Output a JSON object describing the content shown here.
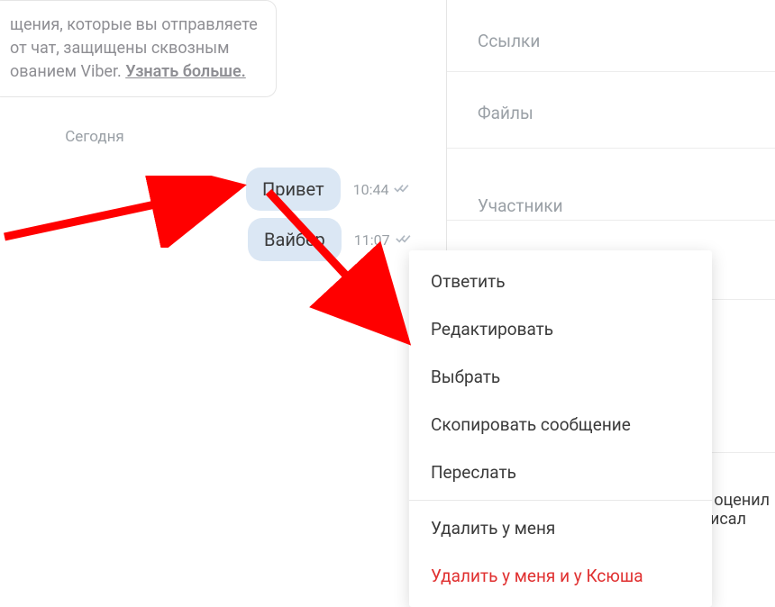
{
  "encryption": {
    "line1": "щения, которые вы отправляете",
    "line2": "от чат, защищены сквозным",
    "line3": "ованием Viber. ",
    "learn_more": "Узнать больше."
  },
  "date_divider": "Сегодня",
  "messages": [
    {
      "text": "Привет",
      "time": "10:44"
    },
    {
      "text": "Вайбер",
      "time": "11:07"
    }
  ],
  "side": {
    "links": "Ссылки",
    "files": "Файлы",
    "participants": "Участники",
    "snippet1": "о оценил",
    "snippet2": "писал"
  },
  "menu": {
    "reply": "Ответить",
    "edit": "Редактировать",
    "select": "Выбрать",
    "copy": "Скопировать сообщение",
    "forward": "Переслать",
    "delete_me": "Удалить у меня",
    "delete_all": "Удалить у меня и у Ксюша"
  }
}
